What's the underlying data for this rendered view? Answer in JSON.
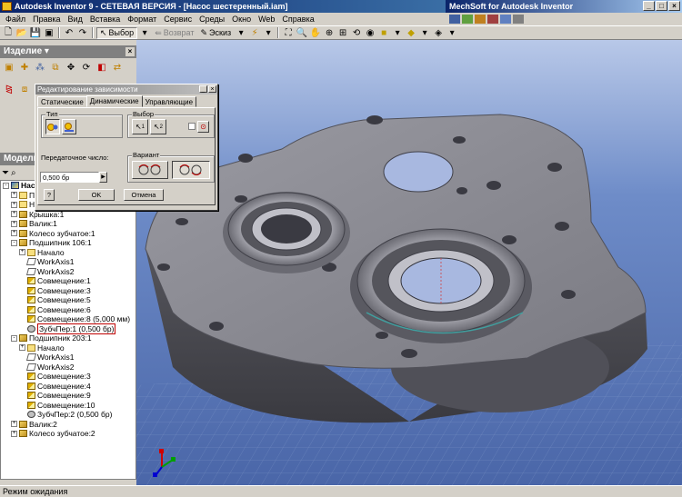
{
  "app": {
    "title": "Autodesk Inventor 9 - СЕТЕВАЯ ВЕРСИЯ - [Насос шестеренный.iam]",
    "mech_title": "MechSoft for Autodesk Inventor"
  },
  "menu": [
    "Файл",
    "Правка",
    "Вид",
    "Вставка",
    "Формат",
    "Сервис",
    "Среды",
    "Окно",
    "Web",
    "Справка"
  ],
  "toolbar": {
    "select_label": "Выбор",
    "return_label": "Возврат",
    "sketch_label": "Эскиз"
  },
  "panel": {
    "title": "Изделие",
    "browser_title": "Модель"
  },
  "dialog": {
    "title": "Редактирование зависимости",
    "tabs": [
      "Статические",
      "Динамические",
      "Управляющие"
    ],
    "active_tab": "Динамические",
    "type_label": "Тип",
    "select_label": "Выбор",
    "select_btn1": "1",
    "select_btn2": "2",
    "ratio_label": "Передаточное число:",
    "ratio_value": "0,500 бр",
    "variant_label": "Вариант",
    "ok_label": "OK",
    "cancel_label": "Отмена",
    "help_label": "?"
  },
  "tree": [
    {
      "label": "Насос",
      "level": 0,
      "icon": "assy",
      "exp": "-",
      "bold": true
    },
    {
      "label": "Пр",
      "level": 1,
      "icon": "folder",
      "exp": "+"
    },
    {
      "label": "Начало",
      "level": 1,
      "icon": "folder",
      "exp": "+"
    },
    {
      "label": "Крышка:1",
      "level": 1,
      "icon": "part",
      "exp": "+"
    },
    {
      "label": "Валик:1",
      "level": 1,
      "icon": "part",
      "exp": "+"
    },
    {
      "label": "Колесо зубчатое:1",
      "level": 1,
      "icon": "part",
      "exp": "+"
    },
    {
      "label": "Подшипник 106:1",
      "level": 1,
      "icon": "part",
      "exp": "-"
    },
    {
      "label": "Начало",
      "level": 2,
      "icon": "folder",
      "exp": "+"
    },
    {
      "label": "WorkAxis1",
      "level": 2,
      "icon": "axis",
      "exp": ""
    },
    {
      "label": "WorkAxis2",
      "level": 2,
      "icon": "axis",
      "exp": ""
    },
    {
      "label": "Совмещение:1",
      "level": 2,
      "icon": "constraint",
      "exp": ""
    },
    {
      "label": "Совмещение:3",
      "level": 2,
      "icon": "constraint",
      "exp": ""
    },
    {
      "label": "Совмещение:5",
      "level": 2,
      "icon": "constraint",
      "exp": ""
    },
    {
      "label": "Совмещение:6",
      "level": 2,
      "icon": "constraint",
      "exp": ""
    },
    {
      "label": "Совмещение:8 (5,000 мм)",
      "level": 2,
      "icon": "constraint",
      "exp": ""
    },
    {
      "label": "ЗубчПер:1 (0,500 бр)",
      "level": 2,
      "icon": "gear",
      "exp": "",
      "highlight": true
    },
    {
      "label": "Подшипник 203:1",
      "level": 1,
      "icon": "part",
      "exp": "-"
    },
    {
      "label": "Начало",
      "level": 2,
      "icon": "folder",
      "exp": "+"
    },
    {
      "label": "WorkAxis1",
      "level": 2,
      "icon": "axis",
      "exp": ""
    },
    {
      "label": "WorkAxis2",
      "level": 2,
      "icon": "axis",
      "exp": ""
    },
    {
      "label": "Совмещение:3",
      "level": 2,
      "icon": "constraint",
      "exp": ""
    },
    {
      "label": "Совмещение:4",
      "level": 2,
      "icon": "constraint",
      "exp": ""
    },
    {
      "label": "Совмещение:9",
      "level": 2,
      "icon": "constraint",
      "exp": ""
    },
    {
      "label": "Совмещение:10",
      "level": 2,
      "icon": "constraint",
      "exp": ""
    },
    {
      "label": "ЗубчПер:2 (0,500 бр)",
      "level": 2,
      "icon": "gear",
      "exp": ""
    },
    {
      "label": "Валик:2",
      "level": 1,
      "icon": "part",
      "exp": "+"
    },
    {
      "label": "Колесо зубчатое:2",
      "level": 1,
      "icon": "part",
      "exp": "+"
    }
  ],
  "status": "Режим ожидания",
  "colors": {
    "titlebar": "#0a246a",
    "viewport_top": "#b8c8e8",
    "viewport_bottom": "#4a66a8",
    "part_fill": "#8a8a90"
  }
}
